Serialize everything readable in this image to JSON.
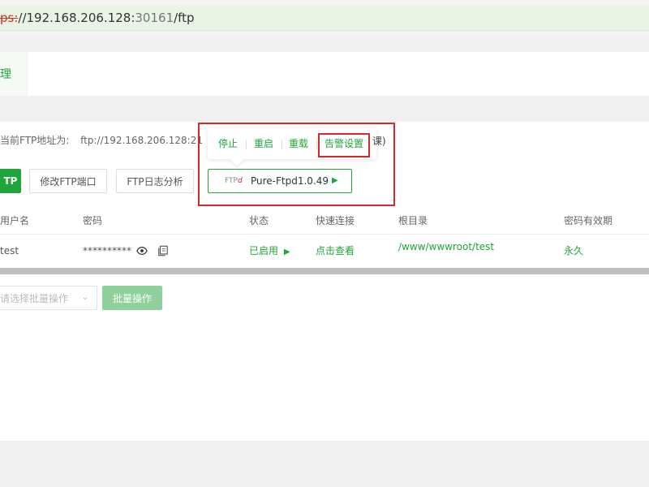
{
  "browser": {
    "url_scheme": "ps:",
    "url_host": "//192.168.206.128:",
    "url_port": "30161",
    "url_path": "/ftp"
  },
  "nav": {
    "active_tab": "理"
  },
  "ftp": {
    "address_label": "当前FTP地址为:",
    "address_value": "ftp://192.168.206.128:21",
    "address_tail": "课)",
    "add_button": "TP",
    "modify_port_button": "修改FTP端口",
    "log_analysis_button": "FTP日志分析",
    "service_logo": "FTP",
    "service_logo_mark": "d",
    "service_name": "Pure-Ftpd1.0.49",
    "play_glyph": "▶"
  },
  "popover": {
    "stop": "停止",
    "restart": "重启",
    "reload": "重载",
    "alert_settings": "告警设置"
  },
  "table": {
    "headers": {
      "username": "用户名",
      "password": "密码",
      "status": "状态",
      "quick_connect": "快速连接",
      "root_dir": "根目录",
      "expiry": "密码有效期"
    },
    "rows": [
      {
        "username": "test",
        "password": "**********",
        "status": "已启用",
        "quick_connect": "点击查看",
        "root_dir": "/www/wwwroot/test",
        "expiry": "永久"
      }
    ]
  },
  "batch": {
    "select_placeholder": "请选择批量操作",
    "button": "批量操作"
  },
  "colors": {
    "accent": "#20a53a",
    "highlight": "#d9262c"
  }
}
